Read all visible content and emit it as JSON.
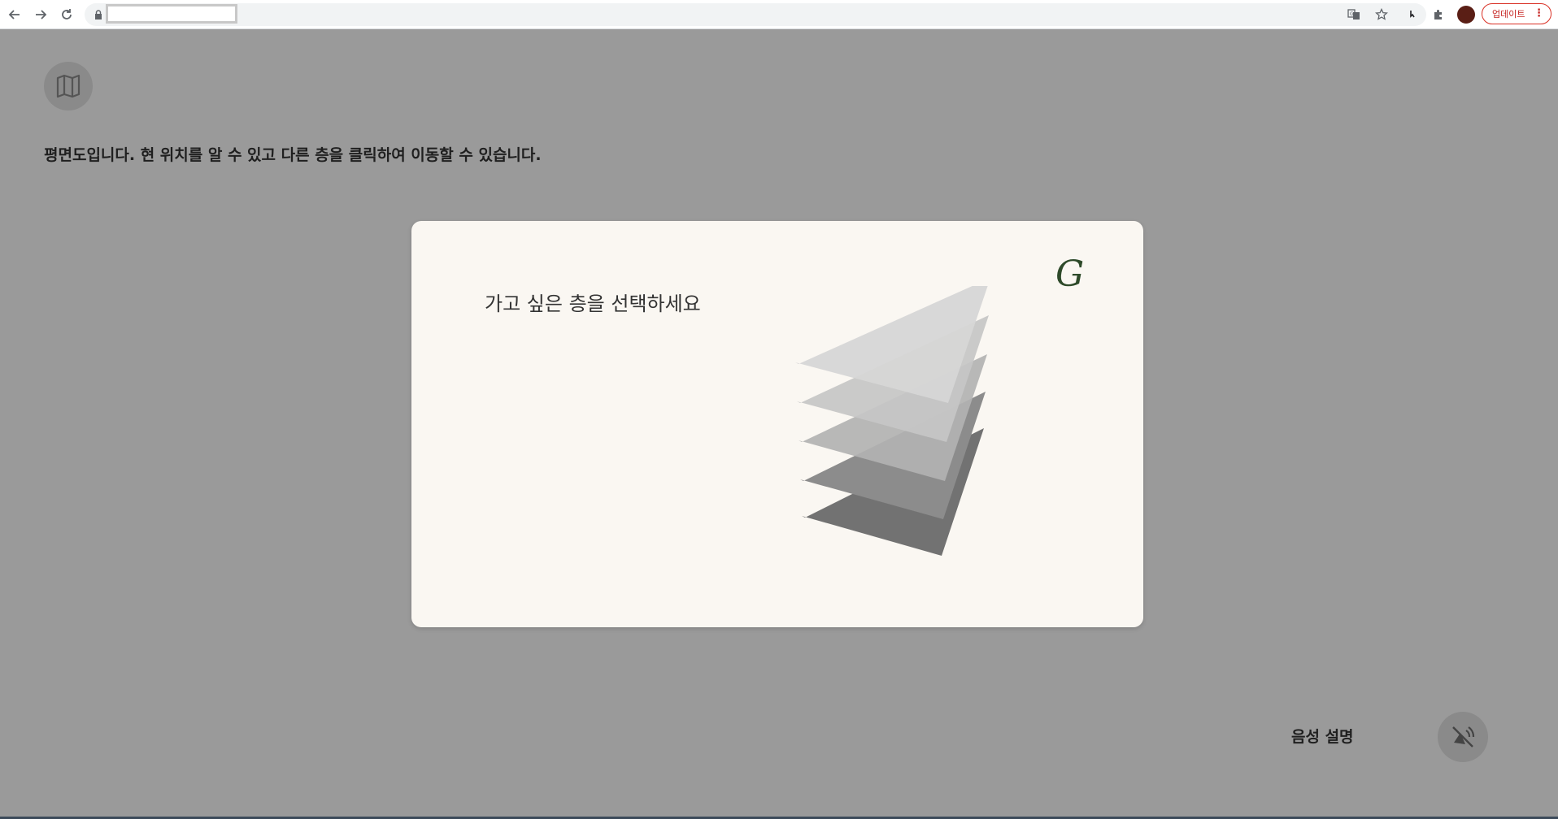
{
  "browser": {
    "back_icon": "arrow-left-icon",
    "forward_icon": "arrow-right-icon",
    "reload_icon": "reload-icon",
    "url": "",
    "update_label": "업데이트",
    "avatar_color": "#5a1e15",
    "update_color": "#d93025"
  },
  "page": {
    "background": "#9a9a9a",
    "map_icon": "map-icon",
    "description": "평면도입니다. 현 위치를 알 수 있고 다른 층을 클릭하여 이동할 수 있습니다.",
    "voice_label": "음성 설명",
    "voice_icon": "speaker-muted-icon"
  },
  "modal": {
    "title": "가고 싶은 층을 선택하세요",
    "logo": "G",
    "background": "#faf7f2",
    "layers": [
      {
        "color": "#d6d6d6"
      },
      {
        "color": "#c6c6c6"
      },
      {
        "color": "#b2b2b2"
      },
      {
        "color": "#8c8c8c"
      },
      {
        "color": "#727272"
      }
    ]
  }
}
